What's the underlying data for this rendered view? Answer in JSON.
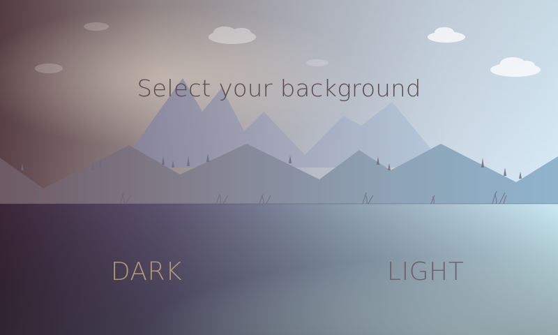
{
  "title": "Select your background",
  "options": {
    "dark": {
      "label": "DARK",
      "color": "#b29a78"
    },
    "light": {
      "label": "LIGHT",
      "color": "#6e5e66"
    }
  },
  "palette": {
    "sky_left": "#5c4448",
    "sky_mid": "#a8a4aa",
    "sky_right": "#d8ebf6",
    "ground_left": "#2a2330",
    "ground_right": "#c4e6ef",
    "mountain_back": "#8c90a4",
    "mountain_front": "#7e7c8c",
    "cloud": "#ffffff"
  }
}
